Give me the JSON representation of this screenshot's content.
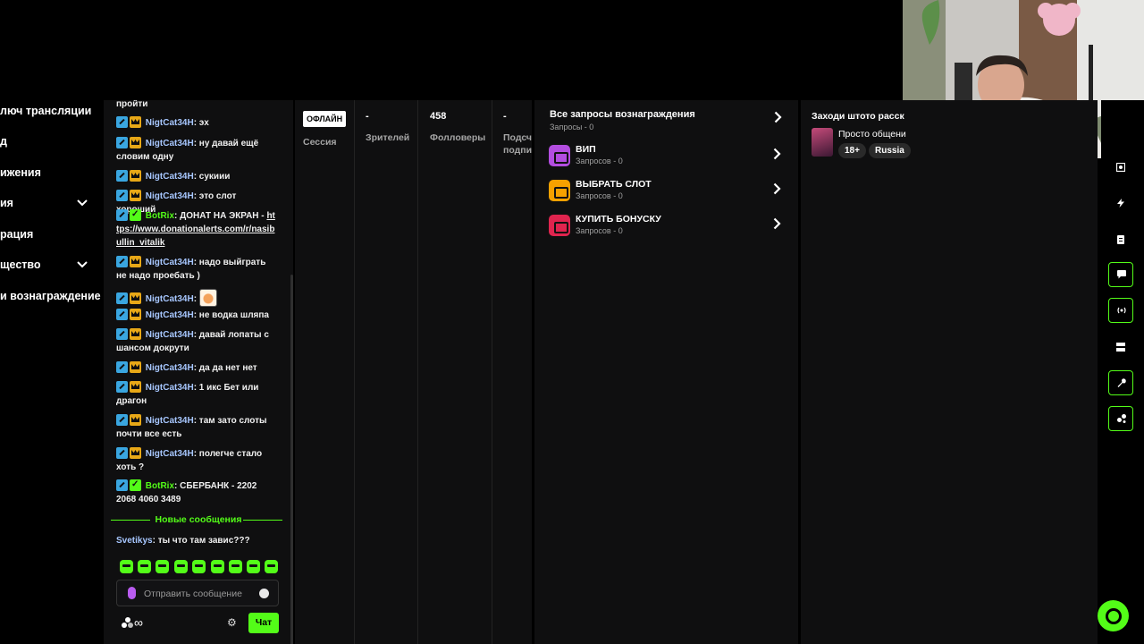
{
  "nav": {
    "items": [
      {
        "label": "люч трансляции",
        "has_chevron": false
      },
      {
        "label": "д",
        "has_chevron": false
      },
      {
        "label": "ижения",
        "has_chevron": false
      },
      {
        "label": "ия",
        "has_chevron": true
      },
      {
        "label": "рация",
        "has_chevron": false
      },
      {
        "label": "щество",
        "has_chevron": true
      },
      {
        "label": "и вознаграждение",
        "has_chevron": false
      }
    ]
  },
  "chat": {
    "messages": [
      {
        "text": "пройти"
      },
      {
        "user": "NigtCat34H",
        "text": "эх"
      },
      {
        "user": "NigtCat34H",
        "text": "ну давай ещё словим одну"
      },
      {
        "user": "NigtCat34H",
        "text": "сукиии"
      },
      {
        "user": "NigtCat34H",
        "text": "это слот хороший"
      },
      {
        "user": "BotRix",
        "text": "ДОНАТ НА ЭКРАН -",
        "link": "https://www.donationalerts.com/r/nasibullin_vitalik"
      },
      {
        "user": "NigtCat34H",
        "text": "надо выйграть не надо проебать )"
      },
      {
        "user": "NigtCat34H",
        "text": ""
      },
      {
        "user": "NigtCat34H",
        "text": "не водка шляпа"
      },
      {
        "user": "NigtCat34H",
        "text": "давай лопаты с шансом докрути"
      },
      {
        "user": "NigtCat34H",
        "text": "да да нет нет"
      },
      {
        "user": "NigtCat34H",
        "text": "1 икс Бет или драгон"
      },
      {
        "user": "NigtCat34H",
        "text": "там зато слоты почти все есть"
      },
      {
        "user": "NigtCat34H",
        "text": "полегче стало хоть ?"
      },
      {
        "user": "BotRix",
        "text": "СБЕРБАНК - 2202 2068 4060 3489"
      }
    ],
    "new_messages_label": "Новые сообщения",
    "new_message": {
      "user": "Svetikys",
      "text": "ты что там завис???"
    },
    "input_placeholder": "Отправить сообщение",
    "points_value": "∞",
    "send_label": "Чат"
  },
  "stats": {
    "status": "ОФЛАЙН",
    "session_label": "Сессия",
    "viewers_value": "-",
    "viewers_label": "Зрителей",
    "followers_value": "458",
    "followers_label": "Фолловеры",
    "subs_value": "-",
    "subs_label_1": "Подсч",
    "subs_label_2": "подпи"
  },
  "rewards": {
    "header": "Все запросы вознаграждения",
    "header_sub": "Запросы - 0",
    "items": [
      {
        "title": "ВИП",
        "requests": "Запросов - 0",
        "color": "#b34de0"
      },
      {
        "title": "ВЫБРАТЬ СЛОТ",
        "requests": "Запросов - 0",
        "color": "#f5a100"
      },
      {
        "title": "КУПИТЬ БОНУСКУ",
        "requests": "Запросов - 0",
        "color": "#e0244e"
      }
    ]
  },
  "stream_info": {
    "title": "Заходи штото расск",
    "category": "Просто общени",
    "tags": [
      "18+",
      "Russia"
    ]
  },
  "rail": {
    "icons": [
      "focus-icon",
      "lightning-icon",
      "notes-icon",
      "chat-icon",
      "broadcast-icon",
      "layout-icon",
      "wrench-icon",
      "share-icon"
    ]
  },
  "colors": {
    "accent": "#53fc18",
    "panel": "#0f0f10",
    "username": "#a7c7ff"
  }
}
